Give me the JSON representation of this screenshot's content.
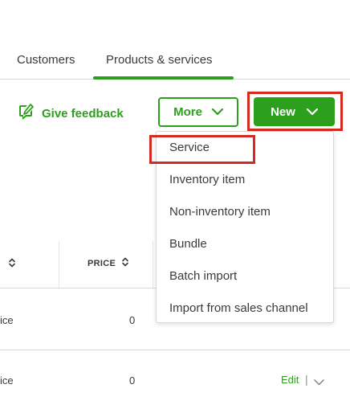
{
  "tabs": [
    {
      "label": "Customers"
    },
    {
      "label": "Products & services"
    }
  ],
  "toolbar": {
    "feedback_label": "Give feedback",
    "more_label": "More",
    "new_label": "New"
  },
  "table": {
    "price_header": "PRICE",
    "rows": [
      {
        "type_fragment": "ice",
        "price": "0"
      },
      {
        "type_fragment": "ice",
        "price": "0",
        "action": "Edit",
        "separator": "|"
      }
    ]
  },
  "new_menu": {
    "items": [
      {
        "label": "Service"
      },
      {
        "label": "Inventory item"
      },
      {
        "label": "Non-inventory item"
      },
      {
        "label": "Bundle"
      },
      {
        "label": "Batch import"
      },
      {
        "label": "Import from sales channel"
      }
    ]
  },
  "colors": {
    "brand_green": "#2ca01c",
    "highlight_red": "#d52b1e",
    "text": "#393a3d",
    "border": "#d4d7dc"
  }
}
